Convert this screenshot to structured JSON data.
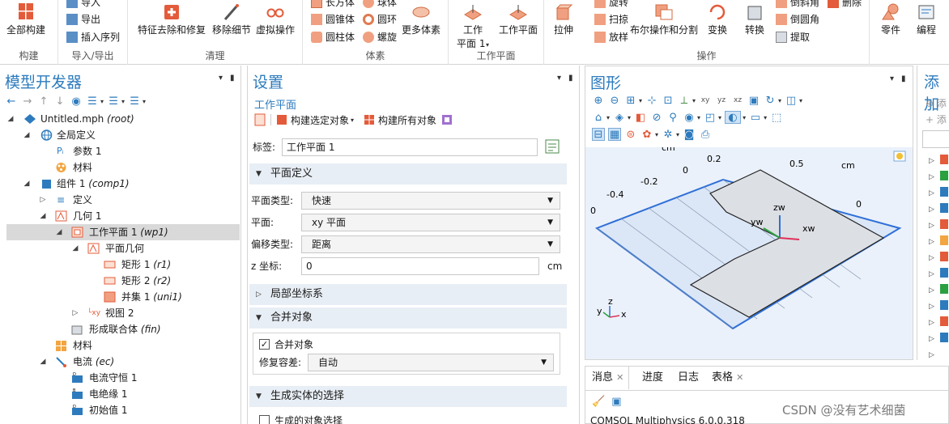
{
  "ribbon": {
    "groups": [
      {
        "label": "构建",
        "buttons": [
          "全部构建"
        ]
      },
      {
        "label": "导入/导出",
        "buttons": [
          "导入",
          "导出",
          "插入序列"
        ]
      },
      {
        "label": "清理",
        "buttons": [
          "特征去除和修复",
          "移除细节",
          "虚拟操作"
        ]
      },
      {
        "label": "体素",
        "buttons": [
          "长方体",
          "球体",
          "圆锥体",
          "圆环",
          "圆柱体",
          "螺旋",
          "更多体素"
        ]
      },
      {
        "label": "工作平面",
        "buttons": [
          "工作",
          "平面 1",
          "工作平面"
        ]
      },
      {
        "label": "操作",
        "buttons": [
          "拉伸",
          "旋转",
          "扫掠",
          "放样",
          "布尔操作和分割",
          "变换",
          "转换",
          "倒斜角",
          "倒圆角",
          "提取",
          "删除"
        ]
      },
      {
        "label": "",
        "buttons": [
          "零件",
          "编程"
        ]
      }
    ]
  },
  "model_builder": {
    "title": "模型开发器",
    "tree": [
      {
        "label": "Untitled.mph",
        "tag": "(root)"
      },
      {
        "label": "全局定义",
        "tag": ""
      },
      {
        "label": "参数 1",
        "tag": ""
      },
      {
        "label": "材料",
        "tag": ""
      },
      {
        "label": "组件 1",
        "tag": "(comp1)"
      },
      {
        "label": "定义",
        "tag": ""
      },
      {
        "label": "几何 1",
        "tag": ""
      },
      {
        "label": "工作平面 1",
        "tag": "(wp1)"
      },
      {
        "label": "平面几何",
        "tag": ""
      },
      {
        "label": "矩形 1",
        "tag": "(r1)"
      },
      {
        "label": "矩形 2",
        "tag": "(r2)"
      },
      {
        "label": "并集 1",
        "tag": "(uni1)"
      },
      {
        "label": "视图 2",
        "tag": ""
      },
      {
        "label": "形成联合体",
        "tag": "(fin)"
      },
      {
        "label": "材料",
        "tag": ""
      },
      {
        "label": "电流",
        "tag": "(ec)"
      },
      {
        "label": "电流守恒 1",
        "tag": ""
      },
      {
        "label": "电绝缘 1",
        "tag": ""
      },
      {
        "label": "初始值 1",
        "tag": ""
      }
    ]
  },
  "settings": {
    "title": "设置",
    "subtitle": "工作平面",
    "build_selected": "构建选定对象",
    "build_all": "构建所有对象",
    "label_caption": "标签:",
    "label_value": "工作平面 1",
    "sections": {
      "plane_def": "平面定义",
      "local_cs": "局部坐标系",
      "union": "合并对象",
      "selection": "生成实体的选择"
    },
    "fields": {
      "plane_type_label": "平面类型:",
      "plane_type_value": "快速",
      "plane_label": "平面:",
      "plane_value": "xy 平面",
      "offset_type_label": "偏移类型:",
      "offset_type_value": "距离",
      "z_label": "z 坐标:",
      "z_value": "0",
      "z_unit": "cm",
      "union_checkbox": "合并对象",
      "repair_tol_label": "修复容差:",
      "repair_tol_value": "自动",
      "gen_selection_checkbox": "生成的对象选择"
    }
  },
  "graphics": {
    "title": "图形",
    "axis_labels": {
      "cm_top": "cm",
      "cm_right": "cm",
      "n0_2": "0.2",
      "n0_top": "0",
      "nm0_2": "-0.2",
      "nm0_4": "-0.4",
      "n0_left": "0",
      "n0_5": "0.5",
      "n0_right": "0",
      "zw": "zw",
      "yw": "yw",
      "xw": "xw",
      "tri_z": "z",
      "tri_y": "y",
      "tri_x": "x"
    }
  },
  "add_panel": {
    "title": "添加",
    "items": [
      "添",
      "添"
    ]
  },
  "bottom": {
    "tabs": [
      "消息",
      "进度",
      "日志",
      "表格"
    ],
    "message": "COMSOL Multiphysics 6.0.0.318"
  },
  "watermark": "CSDN @没有艺术细菌",
  "colors": {
    "accent": "#2d7bbd",
    "geom_fill": "#dcdfe4",
    "plane_fill": "#dbe7f7",
    "section_bg": "#e8eef5"
  }
}
